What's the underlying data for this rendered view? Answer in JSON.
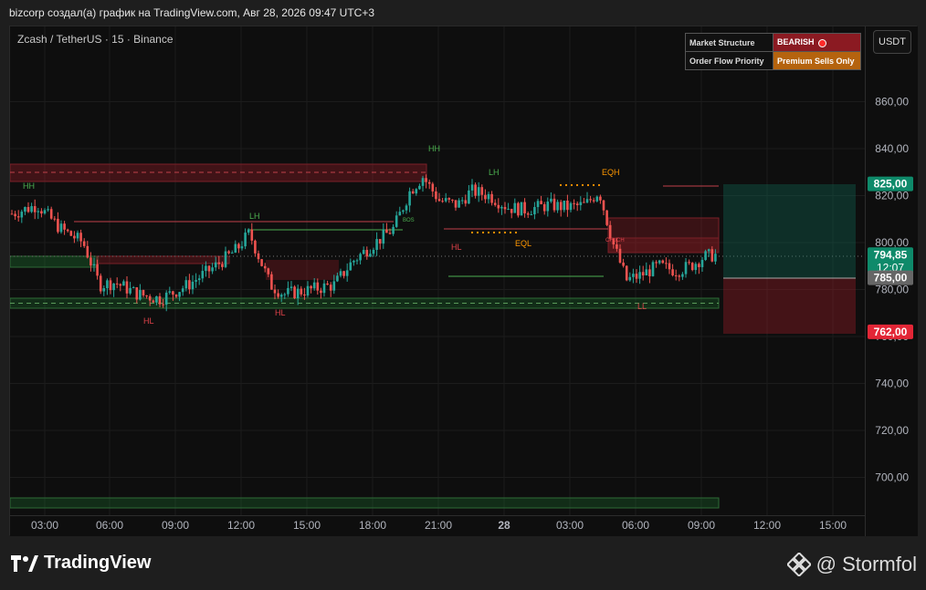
{
  "header": {
    "title": "bizcorp создал(а) график на TradingView.com, Авг 28, 2026 09:47 UTC+3"
  },
  "chart": {
    "symbol": "Zcash / TetherUS · 15 · Binance",
    "currency_button": "USDT",
    "y_ticks": [
      "860,00",
      "840,00",
      "820,00",
      "800,00",
      "780,00",
      "760,00",
      "740,00",
      "720,00",
      "700,00"
    ],
    "x_ticks": [
      "03:00",
      "06:00",
      "09:00",
      "12:00",
      "15:00",
      "18:00",
      "21:00",
      "28",
      "03:00",
      "06:00",
      "09:00",
      "12:00",
      "15:00"
    ],
    "price_labels": {
      "take_profit": "825,00",
      "last_price": "794,85",
      "countdown": "12:07",
      "entry": "785,00",
      "stop": "762,00"
    },
    "price_label_colors": {
      "take_profit": "#0e8a6a",
      "last_price": "#0e8a6a",
      "entry": "#666666",
      "stop": "#e32636"
    },
    "structure_labels": [
      {
        "text": "HH",
        "color": "#4caf50"
      },
      {
        "text": "HL",
        "color": "#e0424a"
      },
      {
        "text": "LH",
        "color": "#4caf50"
      },
      {
        "text": "HL",
        "color": "#e0424a"
      },
      {
        "text": "HH",
        "color": "#4caf50"
      },
      {
        "text": "HL",
        "color": "#e0424a"
      },
      {
        "text": "LH",
        "color": "#4caf50"
      },
      {
        "text": "EQL",
        "color": "#ff9800"
      },
      {
        "text": "EQH",
        "color": "#ff9800"
      },
      {
        "text": "LL",
        "color": "#e0424a"
      },
      {
        "text": "BOS",
        "color": "#4caf50"
      },
      {
        "text": "CHoCH",
        "color": "#e0424a"
      }
    ],
    "info_table": {
      "rows": [
        {
          "key": "Market Structure",
          "value": "BEARISH"
        },
        {
          "key": "Order Flow Priority",
          "value": "Premium Sells Only"
        }
      ]
    },
    "colors": {
      "up": "#26a69a",
      "down": "#ef5350",
      "background": "#0e0e0e",
      "grid": "#1c1c1c"
    }
  },
  "footer": {
    "brand": "TradingView",
    "author": "@ Stormfol"
  }
}
